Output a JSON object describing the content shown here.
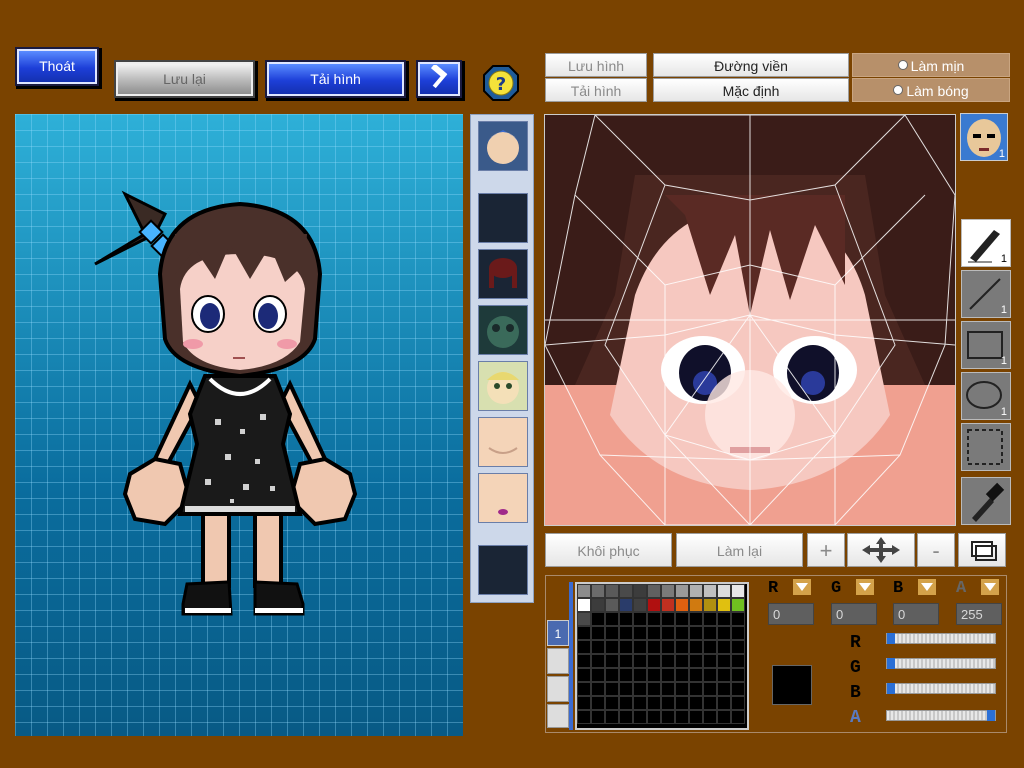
{
  "top_left": {
    "exit_label": "Thoát",
    "save_label": "Lưu lại",
    "load_label": "Tải hình",
    "hammer_icon": "hammer-icon",
    "help_icon": "help-icon",
    "help_glyph": "?"
  },
  "top_right": {
    "save_image_label": "Lưu hình",
    "load_image_label": "Tải hình",
    "outline_label": "Đường viền",
    "default_label": "Mặc định",
    "smooth_label": "Làm mịn",
    "shade_label": "Làm bóng"
  },
  "tools": [
    {
      "name": "pen-tool",
      "count": "1"
    },
    {
      "name": "line-tool",
      "count": "1"
    },
    {
      "name": "rect-tool",
      "count": "1"
    },
    {
      "name": "ellipse-tool",
      "count": "1"
    },
    {
      "name": "select-tool",
      "count": ""
    },
    {
      "name": "eyedropper-tool",
      "count": ""
    }
  ],
  "face_thumb_count": "1",
  "bottom_bar": {
    "restore_label": "Khôi phục",
    "redo_label": "Làm lại",
    "zoom_in_glyph": "+",
    "zoom_out_glyph": "-"
  },
  "palette_tab": "1",
  "color": {
    "r_label": "R",
    "g_label": "G",
    "b_label": "B",
    "a_label": "A",
    "r": "0",
    "g": "0",
    "b": "0",
    "a": "255",
    "r_level": 0,
    "g_level": 0,
    "b_level": 0,
    "a_level": 1,
    "current": "#000000"
  },
  "palette_colors": [
    "#8c8c8c",
    "#6c6c6c",
    "#5a5a5a",
    "#4a4a4a",
    "#3c3c3c",
    "#606060",
    "#7a7a7a",
    "#9a9a9a",
    "#b0b0b0",
    "#c0c0c0",
    "#dcdcdc",
    "#e8e8e8",
    "#ffffff",
    "#3c3c3c",
    "#5a5a5a",
    "#2a3c6a",
    "#404040",
    "#b01010",
    "#c03020",
    "#e06010",
    "#d07a10",
    "#b09010",
    "#e0c010",
    "#70c020",
    "#4a4a4a"
  ]
}
